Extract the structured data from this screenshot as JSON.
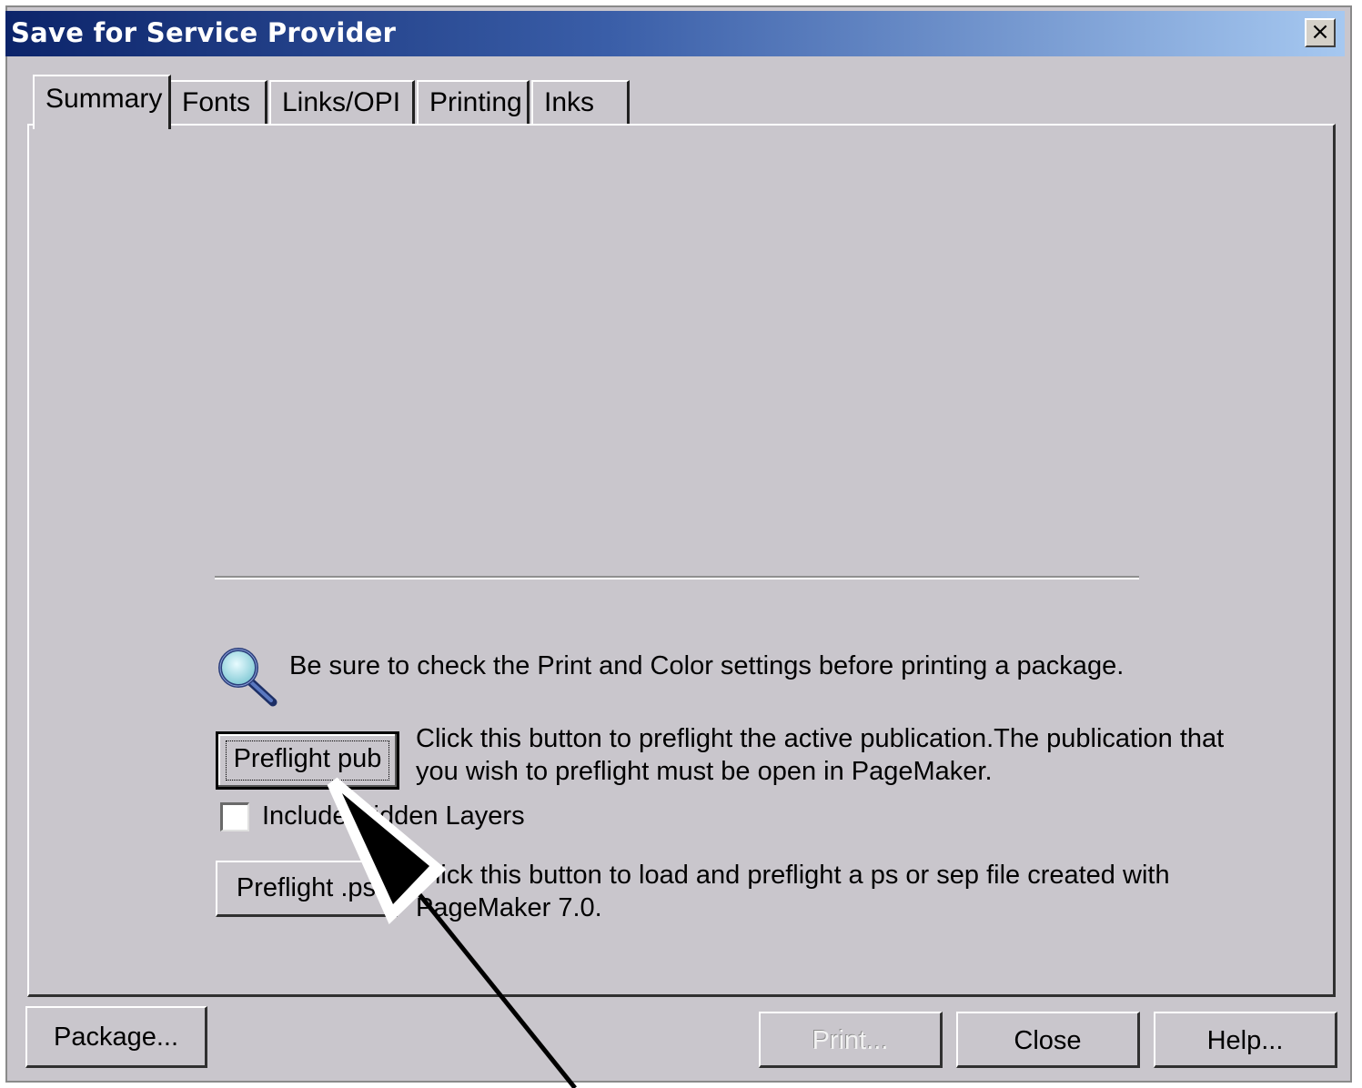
{
  "window": {
    "title": "Save for Service Provider",
    "close_label": "×"
  },
  "tabs": [
    {
      "label": "Summary",
      "active": true
    },
    {
      "label": "Fonts",
      "active": false
    },
    {
      "label": "Links/OPI",
      "active": false
    },
    {
      "label": "Printing",
      "active": false
    },
    {
      "label": "Inks",
      "active": false
    }
  ],
  "summary": {
    "tip_text": "Be sure to check the Print and Color settings before printing a package.",
    "preflight_pub_label": "Preflight pub",
    "preflight_pub_desc_line1": "Click this button to preflight the active publication.The publication that",
    "preflight_pub_desc_line2": "you wish to preflight must be open in PageMaker.",
    "include_hidden_layers_label": "Include Hidden Layers",
    "include_hidden_layers_checked": false,
    "preflight_ps_label": "Preflight .ps",
    "preflight_ps_desc_line1": "Click this button to load and preflight a ps or sep file created with",
    "preflight_ps_desc_line2": "PageMaker 7.0."
  },
  "footer": {
    "package_label": "Package...",
    "print_label": "Print...",
    "print_enabled": false,
    "close_label": "Close",
    "help_label": "Help..."
  },
  "colors": {
    "dialog_bg": "#c9c6cc",
    "titlebar_start": "#0c246a",
    "titlebar_end": "#a6c8f0"
  },
  "icons": [
    "magnifier-icon",
    "arrow-pointer-icon"
  ]
}
